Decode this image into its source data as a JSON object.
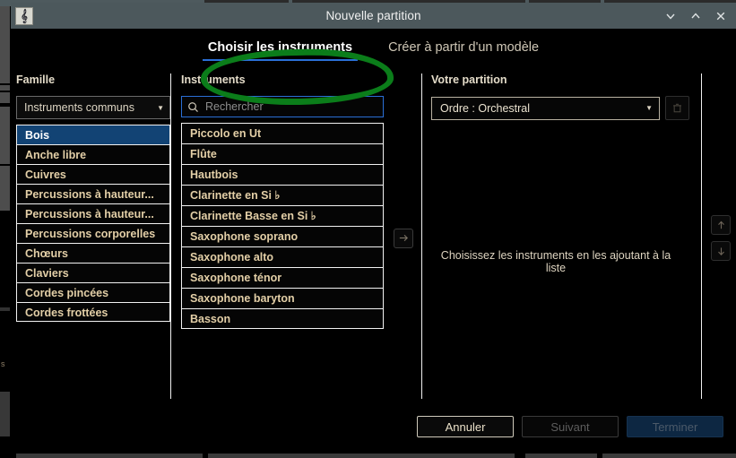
{
  "window": {
    "title": "Nouvelle partition",
    "app_icon": "musescore-icon",
    "controls": [
      {
        "name": "minimize-button",
        "icon": "chevron-down-icon"
      },
      {
        "name": "maximize-button",
        "icon": "chevron-up-icon"
      },
      {
        "name": "close-button",
        "icon": "close-icon"
      }
    ]
  },
  "tabs": [
    {
      "label": "Choisir les instruments",
      "active": true
    },
    {
      "label": "Créer à partir d'un modèle",
      "active": false
    }
  ],
  "annotation": {
    "shape": "hand-drawn-ellipse",
    "color": "#0b7d1a",
    "target": "Choisir les instruments"
  },
  "families": {
    "heading": "Famille",
    "select_value": "Instruments communs",
    "select_caret": "▼",
    "items": [
      {
        "label": "Bois",
        "selected": true
      },
      {
        "label": "Anche libre",
        "selected": false
      },
      {
        "label": "Cuivres",
        "selected": false
      },
      {
        "label": "Percussions à hauteur...",
        "selected": false
      },
      {
        "label": "Percussions à hauteur...",
        "selected": false
      },
      {
        "label": "Percussions corporelles",
        "selected": false
      },
      {
        "label": "Chœurs",
        "selected": false
      },
      {
        "label": "Claviers",
        "selected": false
      },
      {
        "label": "Cordes pincées",
        "selected": false
      },
      {
        "label": "Cordes frottées",
        "selected": false
      }
    ]
  },
  "instruments": {
    "heading": "Instruments",
    "search_placeholder": "Rechercher",
    "search_value": "",
    "search_icon": "search-icon",
    "items": [
      "Piccolo en Ut",
      "Flûte",
      "Hautbois",
      "Clarinette en Si ♭",
      "Clarinette Basse en Si ♭",
      "Saxophone soprano",
      "Saxophone alto",
      "Saxophone ténor",
      "Saxophone baryton",
      "Basson"
    ]
  },
  "transfer": {
    "add_icon": "arrow-right-icon"
  },
  "score": {
    "heading": "Votre partition",
    "order_value": "Ordre : Orchestral",
    "order_caret": "▼",
    "delete_icon": "trash-icon",
    "empty_message": "Choisissez les instruments en les ajoutant à la liste"
  },
  "reorder": {
    "up_icon": "arrow-up-icon",
    "down_icon": "arrow-down-icon"
  },
  "footer": {
    "cancel_label": "Annuler",
    "next_label": "Suivant",
    "finish_label": "Terminer"
  },
  "colors": {
    "titlebar": "#4c585c",
    "accent_blue": "#2a6fd6",
    "selection_blue": "#124374",
    "list_text": "#e3cfa7",
    "annotation_green": "#0b7d1a"
  }
}
